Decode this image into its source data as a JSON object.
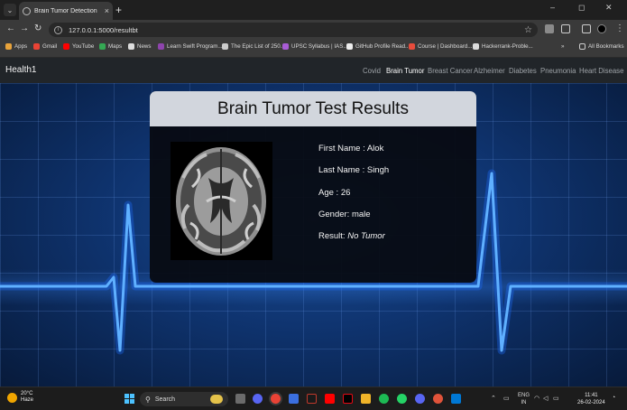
{
  "browser": {
    "tab_title": "Brain Tumor Detection",
    "tab_close": "×",
    "new_tab": "+",
    "window_controls": [
      "–",
      "◻",
      "✕"
    ],
    "url": "127.0.0.1:5000/resultbt",
    "bookmarks": [
      {
        "label": "Apps",
        "color": "#e8a33b"
      },
      {
        "label": "Gmail",
        "color": "#ea4335"
      },
      {
        "label": "YouTube",
        "color": "#ff0000"
      },
      {
        "label": "Maps",
        "color": "#34a853"
      },
      {
        "label": "News",
        "color": "#dddddd"
      },
      {
        "label": "Learn Swift Program...",
        "color": "#8e44ad"
      },
      {
        "label": "The Epic List of 250...",
        "color": "#cccccc"
      },
      {
        "label": "UPSC Syllabus | IAS...",
        "color": "#a85cd6"
      },
      {
        "label": "GitHub Profile Read...",
        "color": "#eeeeee"
      },
      {
        "label": "Course | Dashboard...",
        "color": "#e74c3c"
      },
      {
        "label": "Hackerrank-Proble...",
        "color": "#dddddd"
      }
    ],
    "overflow": "»",
    "all_bookmarks": "All Bookmarks"
  },
  "site": {
    "brand": "Health1",
    "nav": [
      {
        "label": "Covid",
        "active": false
      },
      {
        "label": "Brain Tumor",
        "active": true
      },
      {
        "label": "Breast Cancer",
        "active": false
      },
      {
        "label": "Alzheimer",
        "active": false
      },
      {
        "label": "Diabetes",
        "active": false
      },
      {
        "label": "Pneumonia",
        "active": false
      },
      {
        "label": "Heart Disease",
        "active": false
      }
    ]
  },
  "result": {
    "title": "Brain Tumor Test Results",
    "first_name_label": "First Name : ",
    "first_name": "Alok",
    "last_name_label": "Last Name : ",
    "last_name": "Singh",
    "age_label": "Age : ",
    "age": "26",
    "gender_label": "Gender: ",
    "gender": "male",
    "result_label": "Result: ",
    "result": "No Tumor"
  },
  "taskbar": {
    "temperature": "20°C",
    "condition": "Haze",
    "search_label": "Search",
    "language": "ENG",
    "region": "IN",
    "time": "11:41",
    "date": "26-02-2024"
  },
  "colors": {
    "navbar": "#212529",
    "accent": "#4cc2ff",
    "ecg_line": "#2f8cff"
  }
}
